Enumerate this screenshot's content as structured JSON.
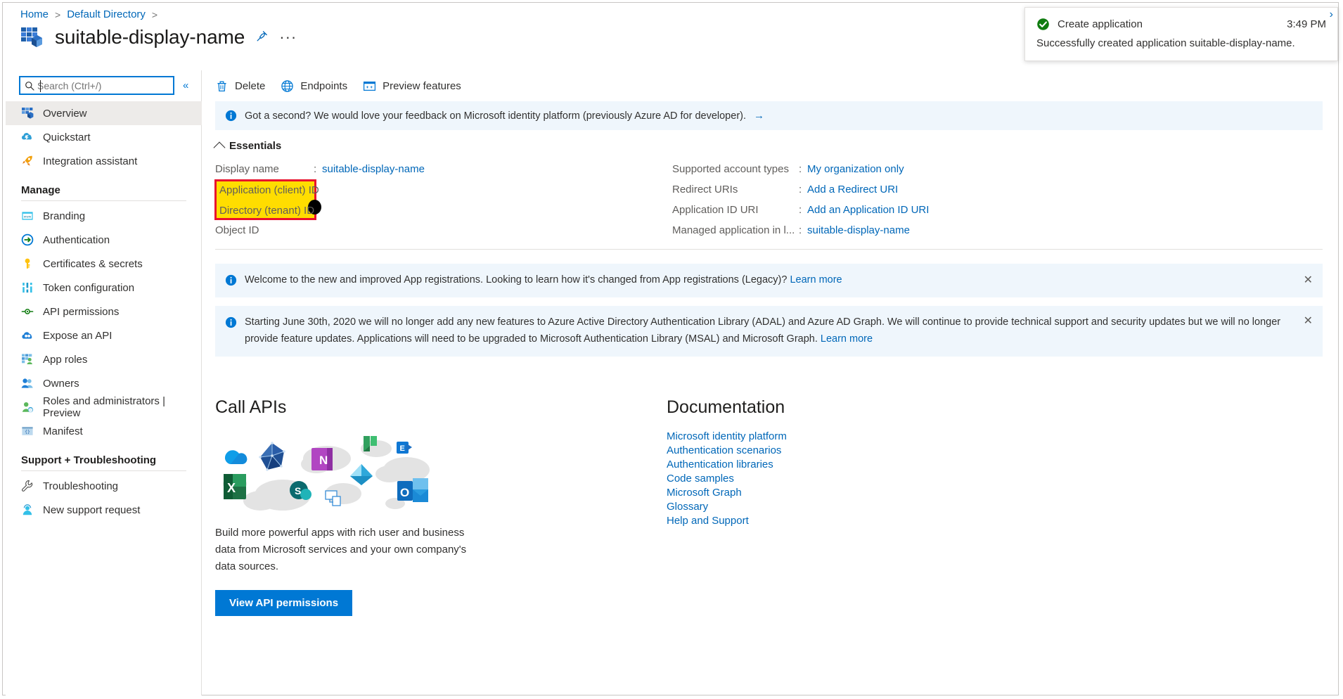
{
  "breadcrumb": {
    "items": [
      {
        "label": "Home"
      },
      {
        "label": "Default Directory"
      }
    ],
    "separator": ">"
  },
  "header": {
    "title": "suitable-display-name",
    "app_icon": "app-registration-icon",
    "pin_label": "☆",
    "more_label": "···"
  },
  "sidebar": {
    "search": {
      "placeholder": "Search (Ctrl+/)",
      "value": "",
      "icon": "search-icon"
    },
    "collapse_label": "«",
    "top_items": [
      {
        "label": "Overview",
        "icon": "overview-icon",
        "selected": true
      },
      {
        "label": "Quickstart",
        "icon": "quickstart-cloud-icon",
        "selected": false
      },
      {
        "label": "Integration assistant",
        "icon": "rocket-icon",
        "selected": false
      }
    ],
    "groups": [
      {
        "title": "Manage",
        "items": [
          {
            "label": "Branding",
            "icon": "branding-icon"
          },
          {
            "label": "Authentication",
            "icon": "authentication-icon"
          },
          {
            "label": "Certificates & secrets",
            "icon": "key-icon"
          },
          {
            "label": "Token configuration",
            "icon": "token-icon"
          },
          {
            "label": "API permissions",
            "icon": "api-permissions-icon"
          },
          {
            "label": "Expose an API",
            "icon": "expose-api-icon"
          },
          {
            "label": "App roles",
            "icon": "app-roles-icon"
          },
          {
            "label": "Owners",
            "icon": "owners-icon"
          },
          {
            "label": "Roles and administrators | Preview",
            "icon": "roles-admins-icon"
          },
          {
            "label": "Manifest",
            "icon": "manifest-icon"
          }
        ]
      },
      {
        "title": "Support + Troubleshooting",
        "items": [
          {
            "label": "Troubleshooting",
            "icon": "wrench-icon"
          },
          {
            "label": "New support request",
            "icon": "support-agent-icon"
          }
        ]
      }
    ]
  },
  "commandbar": {
    "commands": [
      {
        "label": "Delete",
        "icon": "trash-icon"
      },
      {
        "label": "Endpoints",
        "icon": "globe-icon"
      },
      {
        "label": "Preview features",
        "icon": "preview-features-icon"
      }
    ]
  },
  "feedback_bar": {
    "icon": "info-icon",
    "text": "Got a second? We would love your feedback on Microsoft identity platform (previously Azure AD for developer).",
    "arrow": "→"
  },
  "essentials": {
    "heading": "Essentials",
    "collapse_icon": "chevron-up-icon",
    "left_rows": [
      {
        "label": "Display name",
        "colon": ":",
        "value": "suitable-display-name",
        "link": true,
        "highlighted": false
      },
      {
        "label": "Application (client) ID",
        "colon": ":",
        "value": "",
        "link": false,
        "highlighted": true
      },
      {
        "label": "Directory (tenant) ID",
        "colon": ":",
        "value": "",
        "link": false,
        "highlighted": true
      },
      {
        "label": "Object ID",
        "colon": ":",
        "value": "",
        "link": false,
        "highlighted": false
      }
    ],
    "right_rows": [
      {
        "label": "Supported account types",
        "colon": ":",
        "value": "My organization only",
        "link": true
      },
      {
        "label": "Redirect URIs",
        "colon": ":",
        "value": "Add a Redirect URI",
        "link": true
      },
      {
        "label": "Application ID URI",
        "colon": ":",
        "value": "Add an Application ID URI",
        "link": true
      },
      {
        "label": "Managed application in l...",
        "colon": ":",
        "value": "suitable-display-name",
        "link": true
      }
    ],
    "highlight_color": "#ffdd00",
    "highlight_border_color": "#e8112d"
  },
  "banners": [
    {
      "icon": "info-icon",
      "text": "Welcome to the new and improved App registrations. Looking to learn how it's changed from App registrations (Legacy)?",
      "link": "Learn more",
      "dismiss": "✕"
    },
    {
      "icon": "info-icon",
      "text": "Starting June 30th, 2020 we will no longer add any new features to Azure Active Directory Authentication Library (ADAL) and Azure AD Graph. We will continue to provide technical support and security updates but we will no longer provide feature updates. Applications will need to be upgraded to Microsoft Authentication Library (MSAL) and Microsoft Graph.",
      "link": "Learn more",
      "dismiss": "✕"
    }
  ],
  "call_apis": {
    "heading": "Call APIs",
    "art": "microsoft-services-illustration",
    "description": "Build more powerful apps with rich user and business data from Microsoft services and your own company's data sources.",
    "button_label": "View API permissions"
  },
  "documentation": {
    "heading": "Documentation",
    "links": [
      "Microsoft identity platform",
      "Authentication scenarios",
      "Authentication libraries",
      "Code samples",
      "Microsoft Graph",
      "Glossary",
      "Help and Support"
    ]
  },
  "toast": {
    "icon": "success-check-icon",
    "title": "Create application",
    "time": "3:49 PM",
    "body": "Successfully created application suitable-display-name.",
    "close": "›"
  },
  "colors": {
    "accent": "#0078d4",
    "link": "#0067b8",
    "info_bg": "#eff6fc",
    "selected_bg": "#edebe9",
    "success": "#107c10"
  }
}
